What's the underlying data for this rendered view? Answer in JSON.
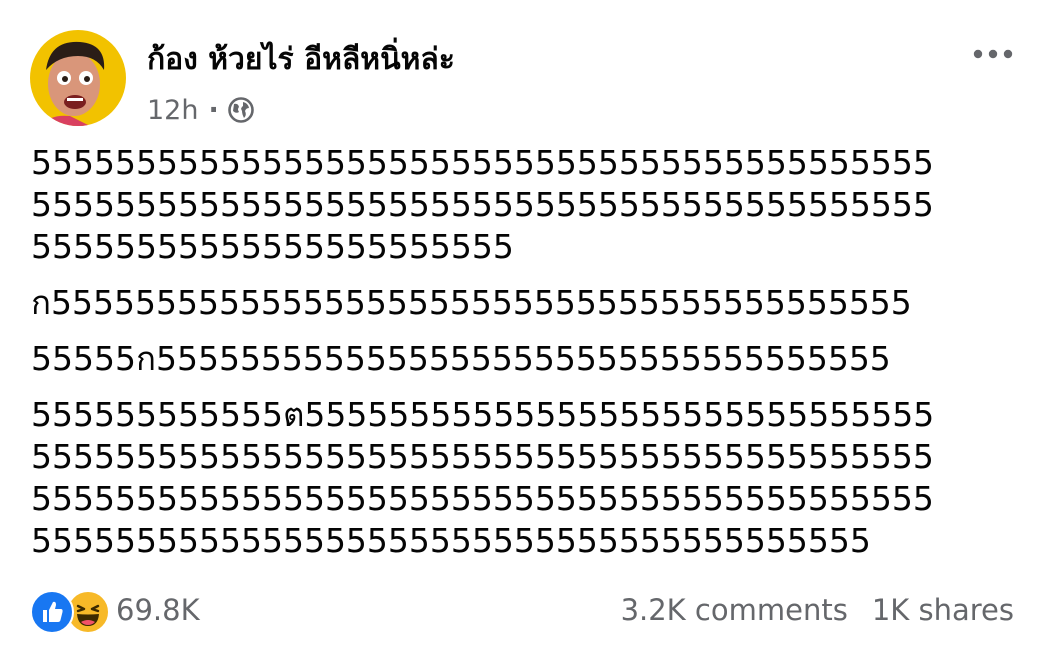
{
  "post": {
    "author": "ก้อง ห้วยไร่ อีหลีหนิ่หล่ะ",
    "time": "12h",
    "separator": "·",
    "privacy_icon": "globe-icon",
    "more_icon": "more-horizontal-icon",
    "paragraphs": [
      {
        "lines": [
          "5555555555555555555555555555555555555555555",
          "5555555555555555555555555555555555555555555",
          "55555555555555555555555"
        ]
      },
      {
        "lines": [
          "ก55555555555555555555555555555555555555555"
        ]
      },
      {
        "lines": [
          "55555ก55555555555555555555555555555555555"
        ]
      },
      {
        "lines": [
          "555555555555ต555555555555555555555555555555",
          "5555555555555555555555555555555555555555555",
          "5555555555555555555555555555555555555555555",
          "5555555555555555555555555555555555555555"
        ]
      }
    ]
  },
  "footer": {
    "reaction_icons": [
      "like-icon",
      "haha-icon"
    ],
    "reaction_count": "69.8K",
    "comments": "3.2K comments",
    "shares": "1K shares"
  },
  "colors": {
    "text": "#050505",
    "secondary": "#65676b",
    "like": "#1877f2",
    "haha": "#f7b928",
    "avatar_bg": "#f2c200"
  }
}
